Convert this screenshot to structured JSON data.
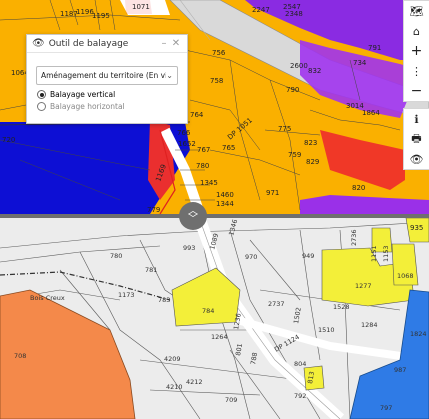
{
  "panel": {
    "title": "Outil de balayage",
    "minimize": "–",
    "close": "✕",
    "layer_select": "Aménagement du territoire (En vigue",
    "options": [
      "Balayage vertical",
      "Balayage horizontal"
    ],
    "selected": "Balayage vertical"
  },
  "toolbar": {
    "icons": [
      "map-icon",
      "home-icon",
      "zoom-in-icon",
      "more-icon",
      "zoom-out-icon",
      "info-icon",
      "print-icon",
      "swipe-icon"
    ]
  },
  "map_top_labels": {
    "p1187": "1187",
    "p1196": "1196",
    "p1195": "1195",
    "p2247": "2247",
    "p1071": "1071",
    "p2348": "2348",
    "p2547": "2547",
    "p756": "756",
    "p791": "791",
    "p734": "734",
    "p2600": "2600",
    "p832": "832",
    "p3014": "3014",
    "p1864": "1864",
    "p758": "758",
    "p790": "790",
    "p1064": "1064",
    "p764": "764",
    "dp1051": "DP 1051",
    "p766": "766",
    "p775": "775",
    "p765": "765",
    "p759": "759",
    "p823": "823",
    "p829": "829",
    "p1652": "1652",
    "p767": "767",
    "p1169": "1169",
    "p820": "820",
    "p971": "971",
    "p1345": "1345",
    "p1460": "1460",
    "p1344": "1344",
    "p779": "779",
    "p720": "720",
    "p780": "780",
    "p935": "935"
  },
  "map_bottom_labels": {
    "p993": "993",
    "p970": "970",
    "p949": "949",
    "p780": "780",
    "p781": "781",
    "p1173": "1173",
    "p783": "783",
    "place": "Bois Creux",
    "p784": "784",
    "p2737": "2737",
    "p1277": "1277",
    "p1068": "1068",
    "p1153": "1153",
    "p1151": "1151",
    "p2736": "2736",
    "p1528": "1528",
    "p1284": "1284",
    "p1510": "1510",
    "p1264": "1264",
    "p1236": "1236",
    "p1502": "1502",
    "p801": "801",
    "p788": "788",
    "p708": "708",
    "p804": "804",
    "p1824": "1824",
    "p987": "987",
    "p813": "813",
    "dp1124": "DP 1124",
    "p709": "709",
    "p4209": "4209",
    "p4212": "4212",
    "p4210": "4210",
    "p792": "792",
    "p797": "797",
    "p1089": "1089",
    "p1346": "1346"
  }
}
